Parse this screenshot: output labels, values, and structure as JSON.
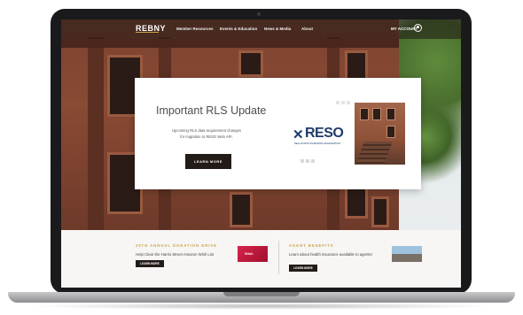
{
  "nav": {
    "logo": "REBNY",
    "items": [
      "Member Resources",
      "Events & Education",
      "News & Media",
      "About"
    ],
    "account_label": "MY ACCOUNT"
  },
  "hero_card": {
    "title": "Important RLS Update",
    "description": "Upcoming RLS data requirement changes for migration to RESO Web API.",
    "button_label": "LEARN MORE",
    "partner_logo": "RESO",
    "partner_tagline": "REAL ESTATE STANDARDS ORGANIZATION"
  },
  "promos": [
    {
      "heading": "25TH ANNUAL DONATION DRIVE",
      "text": "Help Clear the Harris Street Amazon Wish List",
      "button_label": "LEARN MORE",
      "image_label": "Wish"
    },
    {
      "heading": "AGENT BENEFITS",
      "text": "Learn about health insurance available to agents!",
      "button_label": "LEARN MORE"
    }
  ],
  "colors": {
    "accent_gold": "#c9a24a",
    "button_dark": "#231b18",
    "reso_blue": "#1e3c6b",
    "brick": "#7a4330"
  },
  "icons": {
    "account": "user-circle-icon"
  }
}
